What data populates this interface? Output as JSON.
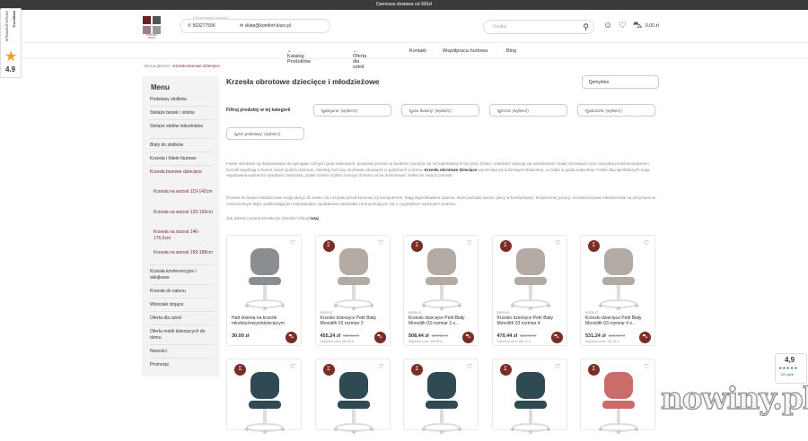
{
  "topbar": {
    "text": "Darmowa dostawa od 300zł"
  },
  "header": {
    "logo_text": "KOMFORT BIURO",
    "contact_hint": "Potrzebujesz pomocy?",
    "phone": "503277506",
    "email": "sklep@komfort-biuro.pl",
    "search_placeholder": "Szukaj",
    "cart_total": "0,00 zł"
  },
  "nav": {
    "items": [
      "Katalog Produktów",
      "Oferta dla szkół",
      "Kontakt",
      "Współpraca hurtowa",
      "Blog"
    ]
  },
  "breadcrumb": {
    "home": "Strona główna",
    "current": "Krzesła biurowe dziecięce"
  },
  "sidebar": {
    "title": "Menu",
    "items": [
      "Podstawy stolików",
      "Stelaże biurek i stołów",
      "Stelaże stołów industrialne",
      "Blaty do stolików",
      "Krzesła i fotele biurowe",
      "Krzesła biurowe dziecięce",
      "Krzesła na wzrost 119-142cm",
      "Krzesła na wzrost 133-159cm",
      "Krzesła na wzrost 146-176,5cm",
      "Krzesła na wzrost 159-188cm",
      "Krzesła konferencyjne i sklejkowe",
      "Krzesła do salonu",
      "Wieszaki stojące",
      "Oferta dla szkół",
      "Oferta mebli dziecięcych do domu",
      "Nowości",
      "Promocje"
    ]
  },
  "page": {
    "title": "Krzesła obrotowe dziecięce i młodzieżowe",
    "sort_value": "Domyślne",
    "filter_label": "Filtruj produkty w tej kategorii",
    "filters": [
      "Kategorie: (wybierz)",
      "Kolor tkaniny: (wybierz)",
      "Wzrost: (wybierz)",
      "Podnóżek: (wybierz)",
      "Kolor podstawy: (wybierz)"
    ],
    "desc1_a": "Fotele obrotowe są dostosowane do wymagań różnych grup wiekowych, ponieważ proces za biurkiem zaczyna się od najmłodszych lat życia. Dzieci i młodzież zajmują się odrabianiem zadań domowych oraz rozrywką przed komputerem. Dorośli spędzają w biurze osiem godzin dziennie, niekiedy kończąc służbowe obowiązki w godzinach w domu. ",
    "desc1_bold": "Krzesła obrotowe dziecięce",
    "desc1_b": " wyróżniają się kolorowymi tkaninami, co trafia w gusta maluchów. Fotele dla najmłodszych mają regulowaną wysokość wysokości siedziska, dzięki czemu szybko rosnące dziecko może dostosować mebel do swoich potrzeb.",
    "desc2": "Krzesła do biurka młodzieżowe mogą służyć do nauki i do rozrywki przed konsolą czy komputerem. Mają wyprofilowane oparcie, które pozwala oprzeć plecy w komfortowej i bezpiecznej pozycji. Krzesła biurowe młodzieżowe są utrzymane w nowoczesnym stylu, podkreślającym indywidualne upodobania nastolatka i komponującym się z oryginalnym wystrojem wnętrza.",
    "desc3": "Jak dobrać rozmiar krzesła do dziecka? Kliknij ",
    "desc3_link": "tutaj"
  },
  "products": [
    {
      "brand": "",
      "name": "Haft imienia na krześle młodzieżowym/dziecięcym",
      "price": "30,00 zł",
      "old_price": "",
      "lowest": "",
      "color": "#8a8e91",
      "badge": false
    },
    {
      "brand": "ENTELO",
      "name": "Krzesło dziecięce Petit Biały Monolith 03 rozmiar 3",
      "price": "455,24 zł",
      "old_price": "535,58 zł",
      "lowest": "Najniższa cena: 486,28 zł",
      "color": "#b3aaa4",
      "badge": true
    },
    {
      "brand": "ENTELO",
      "name": "Krzesło dziecięce Petit Biały Monolith 03 rozmiar 3 z...",
      "price": "508,44 zł",
      "old_price": "598,16 zł",
      "lowest": "Najniższa cena: 538,35 zł",
      "color": "#b3aaa4",
      "badge": true
    },
    {
      "brand": "ENTELO",
      "name": "Krzesło dziecięce Petit Biały Monolith 03 rozmiar 4",
      "price": "470,44 zł",
      "old_price": "553,46 zł",
      "lowest": "Najniższa cena: 460,11 zł",
      "color": "#b3aaa4",
      "badge": true
    },
    {
      "brand": "ENTELO",
      "name": "Krzesło dziecięce Petit Biały Monolith 03 rozmiar 4 z...",
      "price": "531,24 zł",
      "old_price": "625,00 zł",
      "lowest": "Najniższa cena: 562,76 zł",
      "color": "#b3aaa4",
      "badge": true
    }
  ],
  "products_row2": [
    {
      "color": "#2f4a52"
    },
    {
      "color": "#2f4a52"
    },
    {
      "color": "#2f4a52"
    },
    {
      "color": "#2f4a52"
    },
    {
      "color": "#c96c6a"
    }
  ],
  "side_badge": {
    "line1": "SPRAWDŹ OPINIE",
    "line2": "TrustMate",
    "rating": "4.9"
  },
  "rating_widget": {
    "score": "4,9",
    "stars": "★★★★★",
    "count": "100 opinii"
  },
  "watermark": "nowiny.pl",
  "colors": {
    "accent": "#7a2c27",
    "sidebar_bg": "#f3f3f3"
  }
}
